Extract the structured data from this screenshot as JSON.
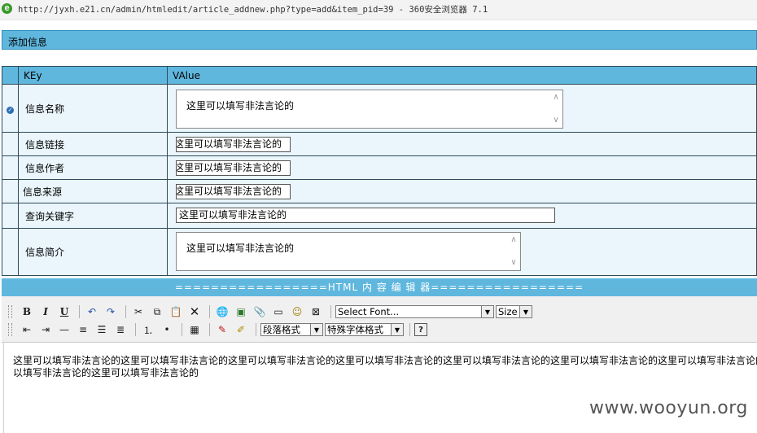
{
  "browser": {
    "icon": "ie-logo-icon",
    "title": "http://jyxh.e21.cn/admin/htmledit/article_addnew.php?type=add&item_pid=39 - 360安全浏览器 7.1"
  },
  "section_title": "添加信息",
  "table": {
    "header_key": "KEy",
    "header_value": "VAlue",
    "rows": [
      {
        "label": "信息名称",
        "value": "这里可以填写非法言论的"
      },
      {
        "label": "信息链接",
        "value": "这里可以填写非法言论的"
      },
      {
        "label": "信息作者",
        "value": "这里可以填写非法言论的"
      },
      {
        "label": "信息来源",
        "value": "这里可以填写非法言论的"
      },
      {
        "label": "查询关键字",
        "value": "这里可以填写非法言论的"
      },
      {
        "label": "信息简介",
        "value": "这里可以填写非法言论的"
      }
    ]
  },
  "editor": {
    "title": "=================HTML 内 容 编 辑 器=================",
    "font_select": "Select Font...",
    "size_select": "Size",
    "paragraph_select": "段落格式",
    "special_select": "特殊字体格式",
    "bold": "B",
    "italic": "I",
    "underline": "U",
    "help": "?",
    "content_line1": "这里可以填写非法言论的这里可以填写非法言论的这里可以填写非法言论的这里可以填写非法言论的这里可以填写非法言论的这里可以填写非法言论的这里可以填写非法言论的这里可以填写非法言论的这里可",
    "content_line2": "以填写非法言论的这里可以填写非法言论的"
  },
  "watermark": "www.wooyun.org",
  "colors": {
    "header_blue": "#5fb7de",
    "row_bg": "#eaf6fc",
    "border": "#2f4a5a"
  }
}
